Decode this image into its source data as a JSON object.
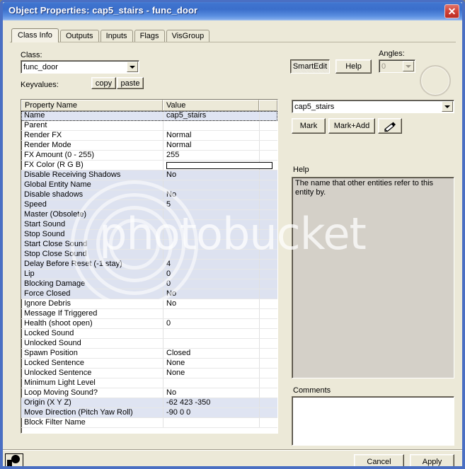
{
  "window": {
    "title": "Object Properties: cap5_stairs - func_door",
    "close_label": "✕",
    "accent_title_color": "#3b6fcb",
    "close_color": "#d2453a",
    "face_color": "#ece9d8"
  },
  "tabs": [
    {
      "label": "Class Info",
      "active": true
    },
    {
      "label": "Outputs",
      "active": false
    },
    {
      "label": "Inputs",
      "active": false
    },
    {
      "label": "Flags",
      "active": false
    },
    {
      "label": "VisGroup",
      "active": false
    }
  ],
  "class_section": {
    "label": "Class:",
    "value": "func_door",
    "keyvalues_label": "Keyvalues:",
    "copy_label": "copy",
    "paste_label": "paste"
  },
  "toolbar": {
    "smartedit_label": "SmartEdit",
    "help_label": "Help",
    "angles_label": "Angles:",
    "angles_value": "0"
  },
  "grid": {
    "columns": [
      "Property Name",
      "Value"
    ],
    "rows": [
      {
        "name": "Name",
        "value": "cap5_stairs",
        "state": "focus"
      },
      {
        "name": "Parent",
        "value": "",
        "state": ""
      },
      {
        "name": "Render FX",
        "value": "Normal",
        "state": ""
      },
      {
        "name": "Render Mode",
        "value": "Normal",
        "state": ""
      },
      {
        "name": "FX Amount (0 - 255)",
        "value": "255",
        "state": ""
      },
      {
        "name": "FX Color (R G B)",
        "value": "",
        "state": "",
        "swatch": "#ffffff"
      },
      {
        "name": "Disable Receiving Shadows",
        "value": "No",
        "state": "hi"
      },
      {
        "name": "Global Entity Name",
        "value": "",
        "state": "hi"
      },
      {
        "name": "Disable shadows",
        "value": "No",
        "state": "hi"
      },
      {
        "name": "Speed",
        "value": "5",
        "state": "hi"
      },
      {
        "name": "Master (Obsolete)",
        "value": "",
        "state": "hi"
      },
      {
        "name": "Start Sound",
        "value": "",
        "state": "hi"
      },
      {
        "name": "Stop Sound",
        "value": "",
        "state": "hi"
      },
      {
        "name": "Start Close Sound",
        "value": "",
        "state": "hi"
      },
      {
        "name": "Stop Close Sound",
        "value": "",
        "state": "hi"
      },
      {
        "name": "Delay Before Reset (-1 stay)",
        "value": "4",
        "state": "hi"
      },
      {
        "name": "Lip",
        "value": "0",
        "state": "hi"
      },
      {
        "name": "Blocking Damage",
        "value": "0",
        "state": "hi"
      },
      {
        "name": "Force Closed",
        "value": "No",
        "state": "hi"
      },
      {
        "name": "Ignore Debris",
        "value": "No",
        "state": ""
      },
      {
        "name": "Message If Triggered",
        "value": "",
        "state": ""
      },
      {
        "name": "Health (shoot open)",
        "value": "0",
        "state": ""
      },
      {
        "name": "Locked Sound",
        "value": "",
        "state": ""
      },
      {
        "name": "Unlocked Sound",
        "value": "",
        "state": ""
      },
      {
        "name": "Spawn Position",
        "value": "Closed",
        "state": ""
      },
      {
        "name": "Locked Sentence",
        "value": "None",
        "state": ""
      },
      {
        "name": "Unlocked Sentence",
        "value": "None",
        "state": ""
      },
      {
        "name": "Minimum Light Level",
        "value": "",
        "state": ""
      },
      {
        "name": "Loop Moving Sound?",
        "value": "No",
        "state": ""
      },
      {
        "name": "Origin (X Y Z)",
        "value": "-62 423 -350",
        "state": "sel"
      },
      {
        "name": "Move Direction (Pitch Yaw Roll)",
        "value": "-90 0 0",
        "state": "sel"
      },
      {
        "name": "Block Filter Name",
        "value": "",
        "state": ""
      }
    ]
  },
  "detail": {
    "value_combo": "cap5_stairs",
    "mark_label": "Mark",
    "mark_add_label": "Mark+Add",
    "eyedropper_name": "eyedropper-icon",
    "help_label": "Help",
    "help_text": "The name that other entities refer to this entity by.",
    "comments_label": "Comments",
    "comments_value": ""
  },
  "footer": {
    "cancel_label": "Cancel",
    "apply_label": "Apply"
  },
  "watermark": {
    "text": "photobucket"
  }
}
